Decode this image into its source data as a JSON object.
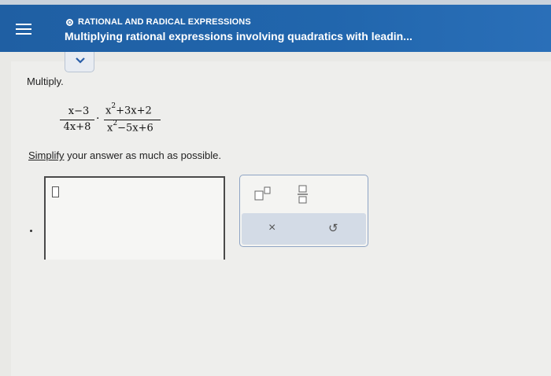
{
  "header": {
    "topic": "RATIONAL AND RADICAL EXPRESSIONS",
    "title": "Multiplying rational expressions involving quadratics with leadin..."
  },
  "question": {
    "prompt": "Multiply.",
    "fraction1": {
      "numerator": "x−3",
      "denominator": "4x+8"
    },
    "operator": "·",
    "fraction2": {
      "numerator_parts": [
        "x",
        "2",
        "+3x+2"
      ],
      "denominator_parts": [
        "x",
        "2",
        "−5x+6"
      ]
    },
    "instruction_link": "Simplify",
    "instruction_rest": " your answer as much as possible."
  },
  "toolbar": {
    "superscript": "superscript-tool",
    "fraction": "fraction-tool",
    "clear": "×",
    "undo": "↺"
  },
  "icons": {
    "menu": "menu-icon",
    "chevron": "chevron-down-icon"
  }
}
